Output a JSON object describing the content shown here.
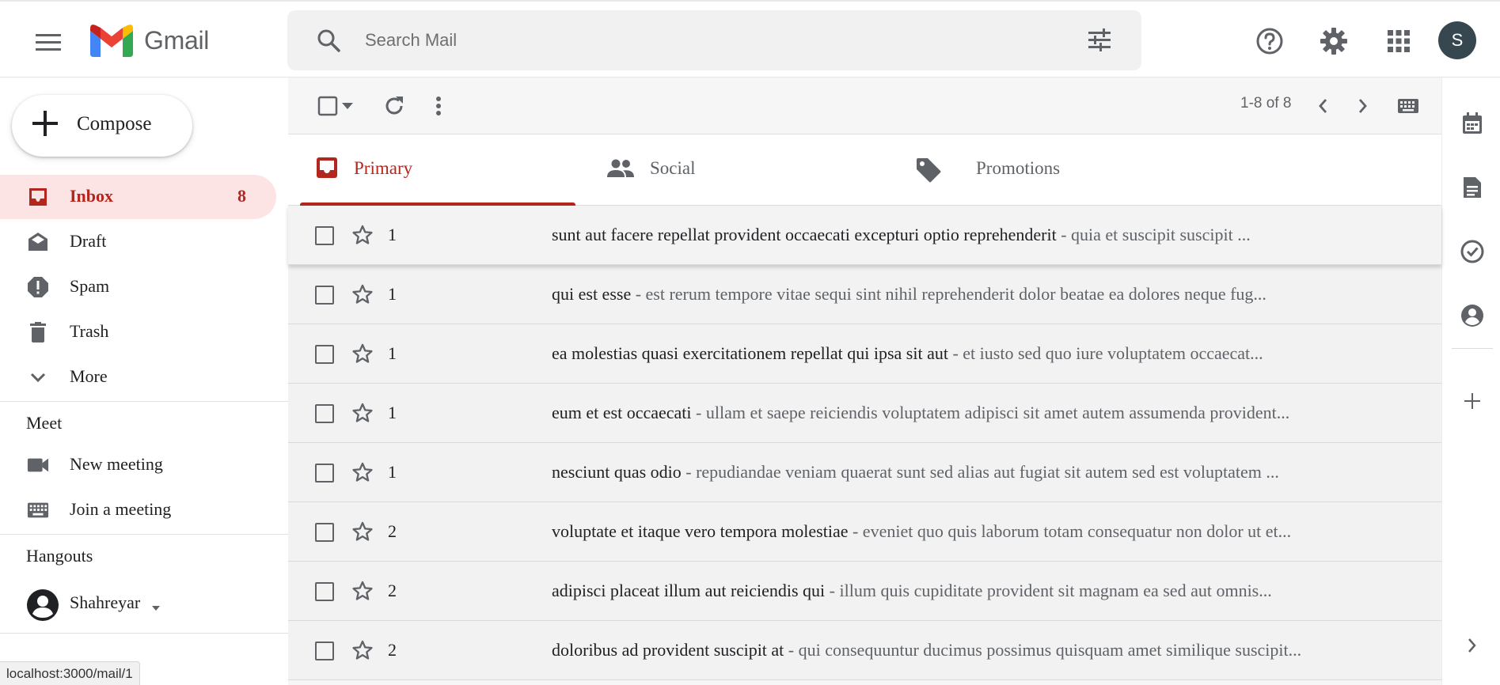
{
  "app": {
    "name": "Gmail"
  },
  "search": {
    "placeholder": "Search Mail",
    "value": ""
  },
  "user": {
    "initial": "S",
    "name": "Shahreyar"
  },
  "compose": {
    "label": "Compose"
  },
  "nav": [
    {
      "label": "Inbox",
      "count": "8",
      "icon": "inbox-icon",
      "active": true
    },
    {
      "label": "Draft",
      "icon": "draft-icon"
    },
    {
      "label": "Spam",
      "icon": "spam-icon"
    },
    {
      "label": "Trash",
      "icon": "trash-icon"
    },
    {
      "label": "More",
      "icon": "chevron-down-icon"
    }
  ],
  "meet": {
    "title": "Meet",
    "items": [
      {
        "label": "New meeting",
        "icon": "video-icon"
      },
      {
        "label": "Join a meeting",
        "icon": "keyboard-icon"
      }
    ]
  },
  "hangouts": {
    "title": "Hangouts"
  },
  "toolbar": {
    "pager": "1-8 of 8"
  },
  "tabs": [
    {
      "label": "Primary",
      "icon": "inbox-icon",
      "active": true
    },
    {
      "label": "Social",
      "icon": "people-icon"
    },
    {
      "label": "Promotions",
      "icon": "tag-icon"
    }
  ],
  "emails": [
    {
      "sender": "1",
      "subject": "sunt aut facere repellat provident occaecati excepturi optio reprehenderit",
      "snippet": " - quia et suscipit suscipit ..."
    },
    {
      "sender": "1",
      "subject": "qui est esse",
      "snippet": " - est rerum tempore vitae sequi sint nihil reprehenderit dolor beatae ea dolores neque fug..."
    },
    {
      "sender": "1",
      "subject": "ea molestias quasi exercitationem repellat qui ipsa sit aut",
      "snippet": " - et iusto sed quo iure voluptatem occaecat..."
    },
    {
      "sender": "1",
      "subject": "eum et est occaecati",
      "snippet": " - ullam et saepe reiciendis voluptatem adipisci sit amet autem assumenda provident..."
    },
    {
      "sender": "1",
      "subject": "nesciunt quas odio",
      "snippet": " - repudiandae veniam quaerat sunt sed alias aut fugiat sit autem sed est voluptatem ..."
    },
    {
      "sender": "2",
      "subject": "voluptate et itaque vero tempora molestiae",
      "snippet": " - eveniet quo quis laborum totam consequatur non dolor ut et..."
    },
    {
      "sender": "2",
      "subject": "adipisci placeat illum aut reiciendis qui",
      "snippet": " - illum quis cupiditate provident sit magnam ea sed aut omnis..."
    },
    {
      "sender": "2",
      "subject": "doloribus ad provident suscipit at",
      "snippet": " - qui consequuntur ducimus possimus quisquam amet similique suscipit..."
    }
  ],
  "status_url": "localhost:3000/mail/1",
  "colors": {
    "accent": "#b3261e",
    "active_bg": "#fce4e4",
    "avatar": "#37474f"
  }
}
